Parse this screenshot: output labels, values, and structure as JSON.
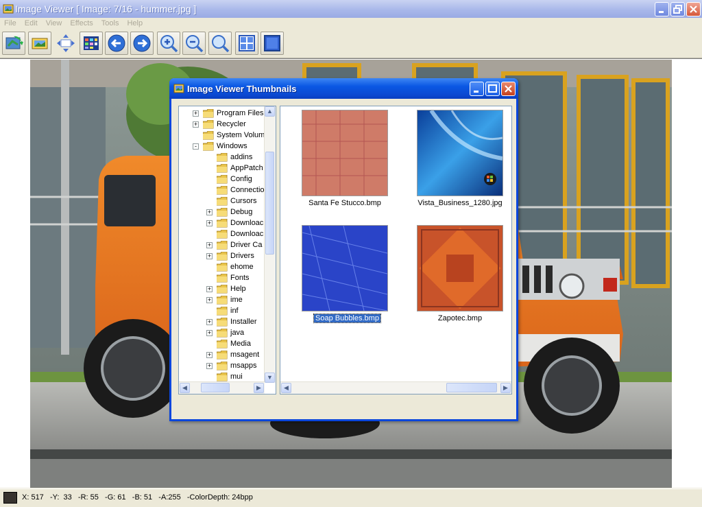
{
  "window": {
    "title": "Image Viewer [ Image: 7/16 - hummer.jpg ]"
  },
  "menu": [
    "File",
    "Edit",
    "View",
    "Effects",
    "Tools",
    "Help"
  ],
  "toolbar": {
    "buttons": [
      "open-icon",
      "slideshow-icon",
      "resize-icon",
      "thumbnails-icon",
      "previous-icon",
      "next-icon",
      "zoom-in-icon",
      "zoom-out-icon",
      "zoom-fit-icon",
      "tile-icon",
      "fullscreen-icon"
    ]
  },
  "status": {
    "text": "X: 517   -Y:  33   -R: 55   -G: 61   -B: 51   -A:255   -ColorDepth: 24bpp",
    "color": "#37332f"
  },
  "dialog": {
    "title": "Image Viewer Thumbnails",
    "tree": [
      {
        "label": "Program Files",
        "expander": "+",
        "level": 0
      },
      {
        "label": "Recycler",
        "expander": "+",
        "level": 0
      },
      {
        "label": "System Volum",
        "expander": "",
        "level": 0
      },
      {
        "label": "Windows",
        "expander": "-",
        "level": 0
      },
      {
        "label": "addins",
        "expander": "",
        "level": 1
      },
      {
        "label": "AppPatch",
        "expander": "",
        "level": 1
      },
      {
        "label": "Config",
        "expander": "",
        "level": 1
      },
      {
        "label": "Connectio",
        "expander": "",
        "level": 1
      },
      {
        "label": "Cursors",
        "expander": "",
        "level": 1
      },
      {
        "label": "Debug",
        "expander": "+",
        "level": 1
      },
      {
        "label": "Downloac",
        "expander": "+",
        "level": 1
      },
      {
        "label": "Downloac",
        "expander": "",
        "level": 1
      },
      {
        "label": "Driver Ca",
        "expander": "+",
        "level": 1
      },
      {
        "label": "Drivers",
        "expander": "+",
        "level": 1
      },
      {
        "label": "ehome",
        "expander": "",
        "level": 1
      },
      {
        "label": "Fonts",
        "expander": "",
        "level": 1
      },
      {
        "label": "Help",
        "expander": "+",
        "level": 1
      },
      {
        "label": "ime",
        "expander": "+",
        "level": 1
      },
      {
        "label": "inf",
        "expander": "",
        "level": 1
      },
      {
        "label": "Installer",
        "expander": "+",
        "level": 1
      },
      {
        "label": "java",
        "expander": "+",
        "level": 1
      },
      {
        "label": "Media",
        "expander": "",
        "level": 1
      },
      {
        "label": "msagent",
        "expander": "+",
        "level": 1
      },
      {
        "label": "msapps",
        "expander": "+",
        "level": 1
      },
      {
        "label": "mui",
        "expander": "",
        "level": 1
      }
    ],
    "thumbnails": [
      {
        "name": "Santa Fe Stucco.bmp",
        "selected": false
      },
      {
        "name": "Vista_Business_1280.jpg",
        "selected": false
      },
      {
        "name": "Soap Bubbles.bmp",
        "selected": true
      },
      {
        "name": "Zapotec.bmp",
        "selected": false
      }
    ]
  }
}
